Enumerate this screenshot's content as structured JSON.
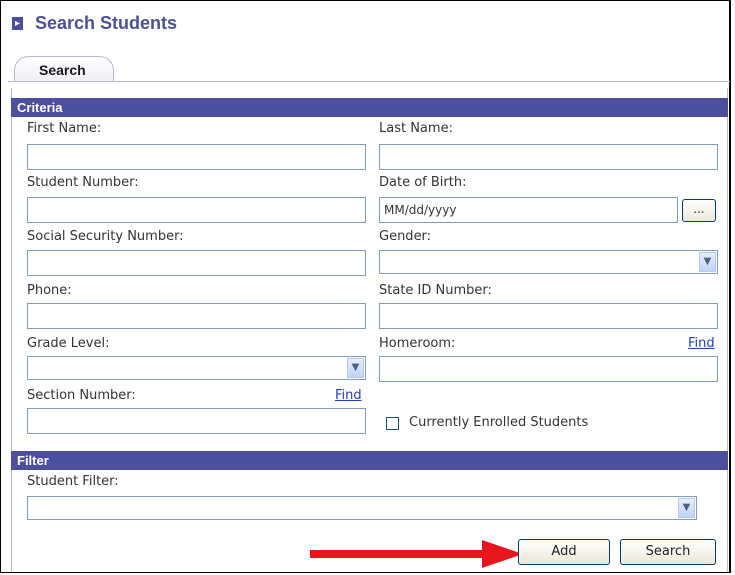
{
  "header": {
    "title": "Search Students",
    "icon": "expand-arrow-icon"
  },
  "tabs": [
    {
      "label": "Search",
      "active": true
    }
  ],
  "criteria": {
    "section_title": "Criteria",
    "first_name": {
      "label": "First Name:",
      "value": ""
    },
    "last_name": {
      "label": "Last Name:",
      "value": ""
    },
    "student_number": {
      "label": "Student Number:",
      "value": ""
    },
    "date_of_birth": {
      "label": "Date of Birth:",
      "value": "MM/dd/yyyy",
      "picker_label": "..."
    },
    "ssn": {
      "label": "Social Security Number:",
      "value": ""
    },
    "gender": {
      "label": "Gender:",
      "selected": ""
    },
    "phone": {
      "label": "Phone:",
      "value": ""
    },
    "state_id": {
      "label": "State ID Number:",
      "value": ""
    },
    "grade_level": {
      "label": "Grade Level:",
      "selected": ""
    },
    "homeroom": {
      "label": "Homeroom:",
      "value": "",
      "find_label": "Find"
    },
    "section_number": {
      "label": "Section Number:",
      "value": "",
      "find_label": "Find"
    },
    "currently_enrolled": {
      "label": "Currently Enrolled Students",
      "checked": false
    }
  },
  "filter": {
    "section_title": "Filter",
    "student_filter": {
      "label": "Student Filter:",
      "selected": ""
    }
  },
  "actions": {
    "add_label": "Add",
    "search_label": "Search"
  },
  "colors": {
    "accent": "#4b4f9d",
    "annotation_arrow": "#e8161c",
    "link": "#1f3fbf"
  }
}
